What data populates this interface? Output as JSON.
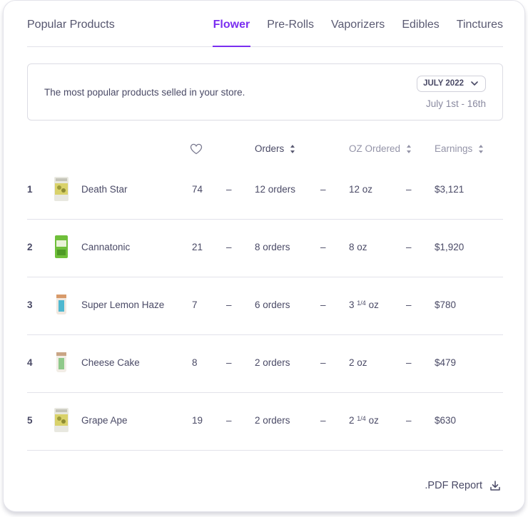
{
  "header": {
    "title": "Popular Products",
    "tabs": [
      {
        "label": "Flower",
        "active": true
      },
      {
        "label": "Pre-Rolls",
        "active": false
      },
      {
        "label": "Vaporizers",
        "active": false
      },
      {
        "label": "Edibles",
        "active": false
      },
      {
        "label": "Tinctures",
        "active": false
      }
    ]
  },
  "info": {
    "text": "The most popular products selled in your store.",
    "month": "JULY 2022",
    "range": "July 1st - 16th"
  },
  "columns": {
    "likes_icon": "heart-icon",
    "orders": "Orders",
    "oz": "OZ Ordered",
    "earnings": "Earnings"
  },
  "rows": [
    {
      "rank": "1",
      "name": "Death Star",
      "likes": "74",
      "orders": "12 orders",
      "oz_whole": "12",
      "oz_frac": "",
      "oz_unit": "oz",
      "earnings": "$3,121",
      "thumb": "yellow"
    },
    {
      "rank": "2",
      "name": "Cannatonic",
      "likes": "21",
      "orders": "8 orders",
      "oz_whole": "8",
      "oz_frac": "",
      "oz_unit": "oz",
      "earnings": "$1,920",
      "thumb": "green"
    },
    {
      "rank": "3",
      "name": "Super Lemon Haze",
      "likes": "7",
      "orders": "6 orders",
      "oz_whole": "3",
      "oz_frac": "1/4",
      "oz_unit": "oz",
      "earnings": "$780",
      "thumb": "jar-blue"
    },
    {
      "rank": "4",
      "name": "Cheese Cake",
      "likes": "8",
      "orders": "2 orders",
      "oz_whole": "2",
      "oz_frac": "",
      "oz_unit": "oz",
      "earnings": "$479",
      "thumb": "jar-green"
    },
    {
      "rank": "5",
      "name": "Grape Ape",
      "likes": "19",
      "orders": "2 orders",
      "oz_whole": "2",
      "oz_frac": "1/4",
      "oz_unit": "oz",
      "earnings": "$630",
      "thumb": "yellow"
    }
  ],
  "dash": "–",
  "footer": {
    "pdf_label": ".PDF Report",
    "icon": "download-icon"
  },
  "colors": {
    "accent": "#7a2ef0",
    "text": "#4a4a66",
    "muted": "#9494a8"
  }
}
